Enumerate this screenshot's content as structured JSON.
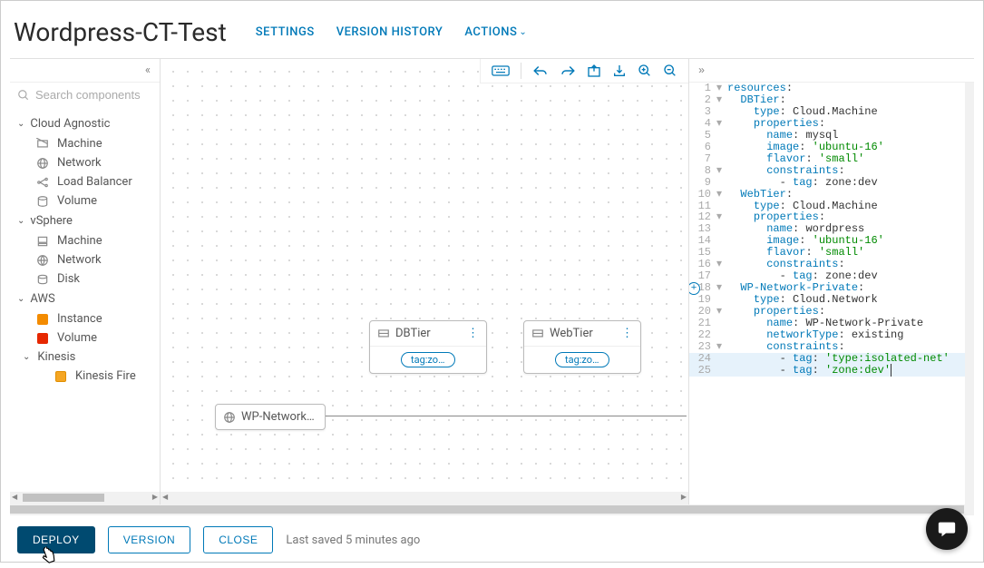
{
  "header": {
    "title": "Wordpress-CT-Test",
    "links": {
      "settings": "SETTINGS",
      "history": "VERSION HISTORY",
      "actions": "ACTIONS"
    }
  },
  "sidebar": {
    "search_placeholder": "Search components",
    "groups": [
      {
        "label": "Cloud Agnostic",
        "items": [
          {
            "label": "Machine",
            "icon": "machine"
          },
          {
            "label": "Network",
            "icon": "network"
          },
          {
            "label": "Load Balancer",
            "icon": "lb"
          },
          {
            "label": "Volume",
            "icon": "volume"
          }
        ]
      },
      {
        "label": "vSphere",
        "items": [
          {
            "label": "Machine",
            "icon": "vm"
          },
          {
            "label": "Network",
            "icon": "vnet"
          },
          {
            "label": "Disk",
            "icon": "disk"
          }
        ]
      },
      {
        "label": "AWS",
        "items": [
          {
            "label": "Instance",
            "icon": "orange"
          },
          {
            "label": "Volume",
            "icon": "red"
          },
          {
            "label": "Kinesis",
            "icon": "group",
            "sub": [
              {
                "label": "Kinesis Fire",
                "icon": "yellow"
              }
            ]
          }
        ]
      }
    ]
  },
  "canvas": {
    "nodes": {
      "db": {
        "title": "DBTier",
        "tag": "tag:zon..."
      },
      "web": {
        "title": "WebTier",
        "tag": "tag:zon..."
      },
      "net": {
        "title": "WP-Network-P..."
      }
    }
  },
  "code": {
    "lines": [
      {
        "n": 1,
        "fold": "▾",
        "ind": 0,
        "key": "resources",
        "after": ":"
      },
      {
        "n": 2,
        "fold": "▾",
        "ind": 1,
        "key": "DBTier",
        "after": ":"
      },
      {
        "n": 3,
        "fold": "",
        "ind": 2,
        "key": "type",
        "after": ": ",
        "val": "Cloud.Machine"
      },
      {
        "n": 4,
        "fold": "▾",
        "ind": 2,
        "key": "properties",
        "after": ":"
      },
      {
        "n": 5,
        "fold": "",
        "ind": 3,
        "key": "name",
        "after": ": ",
        "val": "mysql"
      },
      {
        "n": 6,
        "fold": "",
        "ind": 3,
        "key": "image",
        "after": ": ",
        "str": "'ubuntu-16'"
      },
      {
        "n": 7,
        "fold": "",
        "ind": 3,
        "key": "flavor",
        "after": ": ",
        "str": "'small'"
      },
      {
        "n": 8,
        "fold": "▾",
        "ind": 3,
        "key": "constraints",
        "after": ":"
      },
      {
        "n": 9,
        "fold": "",
        "ind": 4,
        "dash": true,
        "key": "tag",
        "after": ": ",
        "val": "zone:dev"
      },
      {
        "n": 10,
        "fold": "▾",
        "ind": 1,
        "key": "WebTier",
        "after": ":"
      },
      {
        "n": 11,
        "fold": "",
        "ind": 2,
        "key": "type",
        "after": ": ",
        "val": "Cloud.Machine"
      },
      {
        "n": 12,
        "fold": "▾",
        "ind": 2,
        "key": "properties",
        "after": ":"
      },
      {
        "n": 13,
        "fold": "",
        "ind": 3,
        "key": "name",
        "after": ": ",
        "val": "wordpress"
      },
      {
        "n": 14,
        "fold": "",
        "ind": 3,
        "key": "image",
        "after": ": ",
        "str": "'ubuntu-16'"
      },
      {
        "n": 15,
        "fold": "",
        "ind": 3,
        "key": "flavor",
        "after": ": ",
        "str": "'small'"
      },
      {
        "n": 16,
        "fold": "▾",
        "ind": 3,
        "key": "constraints",
        "after": ":"
      },
      {
        "n": 17,
        "fold": "",
        "ind": 4,
        "dash": true,
        "key": "tag",
        "after": ": ",
        "val": "zone:dev"
      },
      {
        "n": 18,
        "fold": "▾",
        "ind": 1,
        "key": "WP-Network-Private",
        "after": ":",
        "add": true
      },
      {
        "n": 19,
        "fold": "",
        "ind": 2,
        "key": "type",
        "after": ": ",
        "val": "Cloud.Network"
      },
      {
        "n": 20,
        "fold": "▾",
        "ind": 2,
        "key": "properties",
        "after": ":"
      },
      {
        "n": 21,
        "fold": "",
        "ind": 3,
        "key": "name",
        "after": ": ",
        "val": "WP-Network-Private"
      },
      {
        "n": 22,
        "fold": "",
        "ind": 3,
        "key": "networkType",
        "after": ": ",
        "val": "existing"
      },
      {
        "n": 23,
        "fold": "▾",
        "ind": 3,
        "key": "constraints",
        "after": ":"
      },
      {
        "n": 24,
        "fold": "",
        "ind": 4,
        "dash": true,
        "key": "tag",
        "after": ": ",
        "str": "'type:isolated-net'",
        "hl": true
      },
      {
        "n": 25,
        "fold": "",
        "ind": 4,
        "dash": true,
        "key": "tag",
        "after": ": ",
        "str": "'zone:dev'",
        "hl": true,
        "cursor": true
      }
    ]
  },
  "footer": {
    "deploy": "DEPLOY",
    "version": "VERSION",
    "close": "CLOSE",
    "saved": "Last saved 5 minutes ago"
  }
}
